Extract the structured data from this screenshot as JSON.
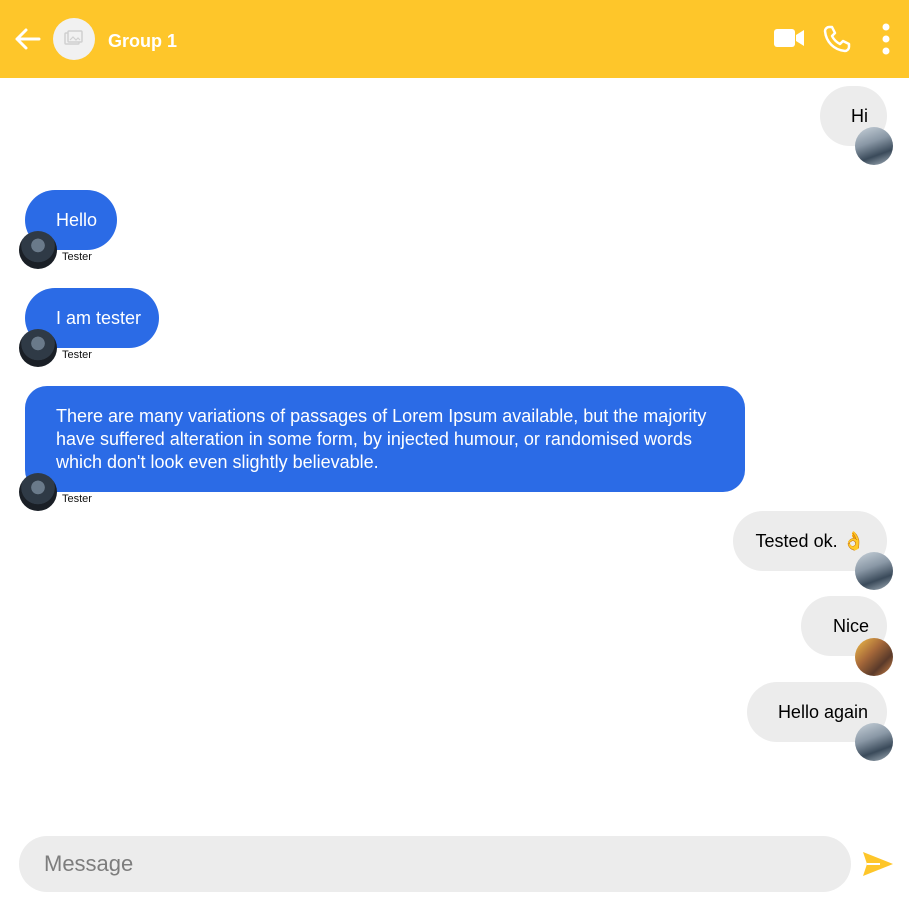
{
  "header": {
    "title": "Group 1",
    "background_color": "#fec62a",
    "icons": [
      "back-arrow-icon",
      "image-placeholder-icon",
      "video-camera-icon",
      "phone-icon",
      "more-vertical-icon"
    ]
  },
  "messages": [
    {
      "direction": "outgoing",
      "text": "Hi",
      "sender": ""
    },
    {
      "direction": "incoming",
      "text": "Hello",
      "sender": "Tester"
    },
    {
      "direction": "incoming",
      "text": "I am tester",
      "sender": "Tester"
    },
    {
      "direction": "incoming",
      "text": "There are many variations of passages of Lorem Ipsum available, but the majority have suffered alteration in some form, by injected humour, or randomised words which don't look even slightly believable.",
      "sender": "Tester"
    },
    {
      "direction": "outgoing",
      "text": "Tested ok. 👌",
      "sender": ""
    },
    {
      "direction": "outgoing",
      "text": "Nice",
      "sender": ""
    },
    {
      "direction": "outgoing",
      "text": "Hello again",
      "sender": ""
    }
  ],
  "composer": {
    "placeholder": "Message",
    "value": ""
  },
  "colors": {
    "incoming_bubble": "#2b6be6",
    "outgoing_bubble": "#ececec",
    "accent": "#fec62a"
  }
}
